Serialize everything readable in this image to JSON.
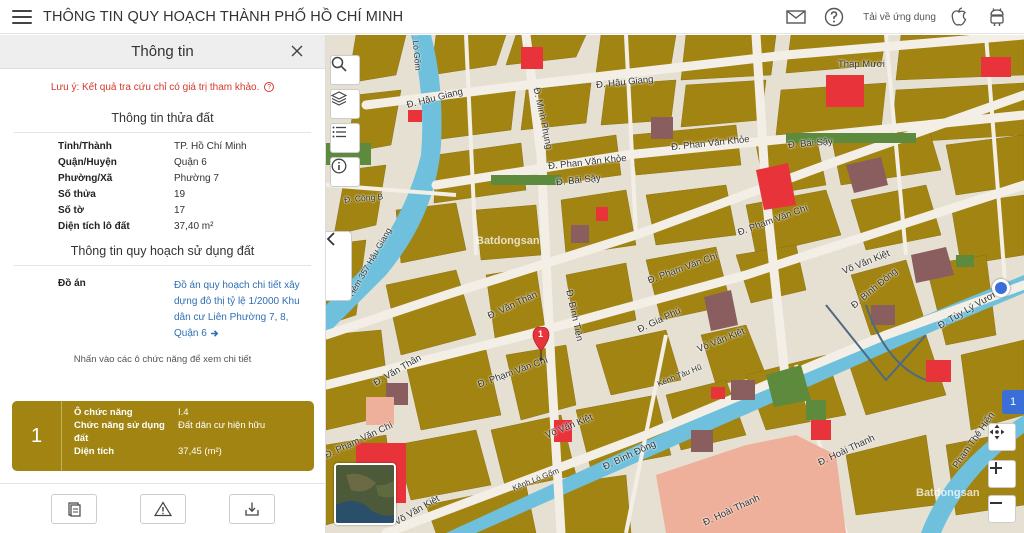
{
  "header": {
    "title": "THÔNG TIN QUY HOẠCH THÀNH PHỐ HỒ CHÍ MINH",
    "download_text": "Tải về ứng dụng"
  },
  "panel": {
    "title": "Thông tin",
    "note": "Lưu ý: Kết quả tra cứu chỉ có giá trị tham khảo.",
    "land_section_title": "Thông tin thửa đất",
    "land_info": [
      {
        "label": "Tỉnh/Thành",
        "value": "TP. Hồ Chí Minh"
      },
      {
        "label": "Quận/Huyện",
        "value": "Quận 6"
      },
      {
        "label": "Phường/Xã",
        "value": "Phường 7"
      },
      {
        "label": "Số thửa",
        "value": "19"
      },
      {
        "label": "Số tờ",
        "value": "17"
      },
      {
        "label": "Diện tích lô đất",
        "value": "37,40 m²"
      }
    ],
    "plan_section_title": "Thông tin quy hoạch sử dụng đất",
    "plan_label": "Đồ án",
    "plan_link": "Đồ án quy hoạch chi tiết xây dựng đô thị tỷ lệ 1/2000 Khu dân cư Liên Phường 7, 8, Quận 6",
    "hint": "Nhấn vào các ô chức năng để xem chi tiết",
    "card": {
      "number": "1",
      "rows": [
        {
          "label": "Ô chức năng",
          "value": "I.4"
        },
        {
          "label": "Chức năng sử dụng đất",
          "value": "Đất dân cư hiện hữu"
        },
        {
          "label": "Diện tích",
          "value": "37,45 (m²)"
        }
      ]
    }
  },
  "map": {
    "labels": [
      {
        "text": "Đ. Hậu Giang"
      },
      {
        "text": "Đ. Hậu Giang"
      },
      {
        "text": "Tháp Mười"
      },
      {
        "text": "Đ. Phan Văn Khỏe"
      },
      {
        "text": "Đ. Phan Văn Khỏe"
      },
      {
        "text": "Đ. Bãi Sậy"
      },
      {
        "text": "Đ. Bãi Sậy"
      },
      {
        "text": "Đ. Minh Phụng"
      },
      {
        "text": "Đ. Phạm Văn Chí"
      },
      {
        "text": "Đ. Phạm Văn Chí"
      },
      {
        "text": "Đ. Phạm Văn Chí"
      },
      {
        "text": "Đ. Phạm Văn Chí"
      },
      {
        "text": "Võ Văn Kiệt"
      },
      {
        "text": "Võ Văn Kiệt"
      },
      {
        "text": "Võ Văn Kiệt"
      },
      {
        "text": "Võ Văn Kiệt"
      },
      {
        "text": "Đ. Bình Tiên"
      },
      {
        "text": "Đ. Văn Thân"
      },
      {
        "text": "Đ. Văn Thân"
      },
      {
        "text": "Đ. Gia Phú"
      },
      {
        "text": "Đ. Bình Đông"
      },
      {
        "text": "Đ. Bình Đông"
      },
      {
        "text": "Đ. Hoài Thanh"
      },
      {
        "text": "Đ. Hoài Thanh"
      },
      {
        "text": "Đ. Tùy Lý Vương"
      },
      {
        "text": "Phạm Thế Hiển"
      },
      {
        "text": "Kênh Tàu Hũ"
      },
      {
        "text": "Kênh Lò Gốm"
      },
      {
        "text": "Hẻm 357 Hậu Giang"
      },
      {
        "text": "Đ. Lò Gốm"
      },
      {
        "text": "Đ. Công B"
      }
    ],
    "pin_label": "1",
    "layer_badge": "1",
    "watermark": "Batdongsan"
  },
  "colors": {
    "land_brown": "#a28412",
    "road": "#e6e0d3",
    "canal": "#6ec0dc",
    "red_zone": "#e8333a",
    "park": "#5d8a3c",
    "pink": "#eeb09a",
    "mauve": "#8a5e5e",
    "link": "#2f6fb5",
    "note_red": "#d4382c"
  },
  "icons": [
    "menu-icon",
    "mail-icon",
    "help-icon",
    "apple-icon",
    "android-icon",
    "close-icon",
    "search-icon",
    "layers-icon",
    "list-icon",
    "info-icon",
    "chevron-left-icon",
    "locate-icon",
    "plus-icon",
    "minus-icon",
    "report-icon",
    "warning-icon",
    "download-icon",
    "arrow-right-icon",
    "map-pin-icon"
  ]
}
